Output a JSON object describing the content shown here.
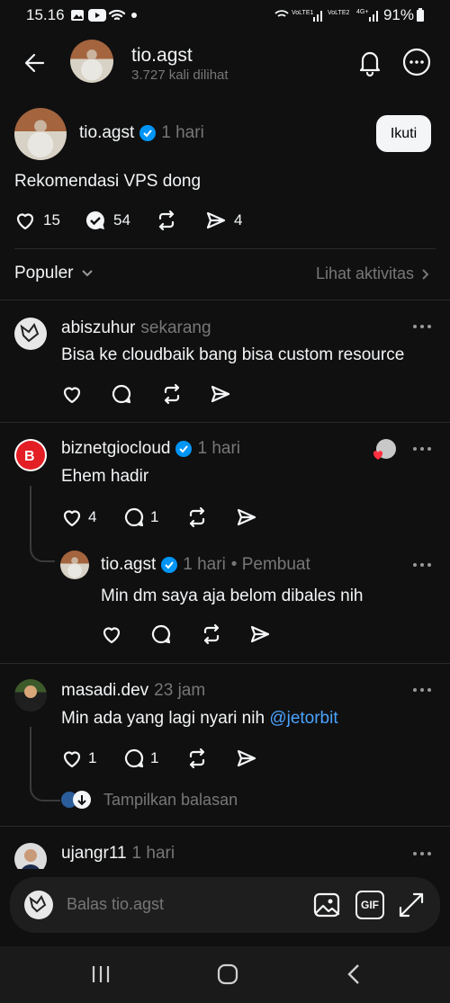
{
  "status_bar": {
    "time": "15.16",
    "battery": "91%"
  },
  "header": {
    "username": "tio.agst",
    "views": "3.727 kali dilihat"
  },
  "post": {
    "author": "tio.agst",
    "time": "1 hari",
    "follow_label": "Ikuti",
    "text": "Rekomendasi VPS dong",
    "likes": "15",
    "replies": "54",
    "shares": "4"
  },
  "sort": {
    "label": "Populer",
    "activity_link": "Lihat aktivitas"
  },
  "replies": [
    {
      "author": "abiszuhur",
      "time": "sekarang",
      "text": "Bisa ke cloudbaik bang bisa custom resource"
    },
    {
      "author": "biznetgiocloud",
      "time": "1 hari",
      "text": "Ehem hadir",
      "likes": "4",
      "replies": "1"
    },
    {
      "author": "tio.agst",
      "time": "1 hari",
      "creator_tag": "• Pembuat",
      "text": "Min dm saya aja belom dibales nih"
    },
    {
      "author": "masadi.dev",
      "time": "23 jam",
      "text_prefix": "Min ada yang lagi nyari nih ",
      "mention": "@jetorbit",
      "likes": "1",
      "replies": "1",
      "show_replies": "Tampilkan balasan"
    },
    {
      "author": "ujangr11",
      "time": "1 hari"
    }
  ],
  "composer": {
    "placeholder": "Balas tio.agst",
    "gif_label": "GIF"
  },
  "colors": {
    "background": "#101010",
    "verified": "#0095f6",
    "mention": "#4aa3ff",
    "muted": "#777777"
  }
}
